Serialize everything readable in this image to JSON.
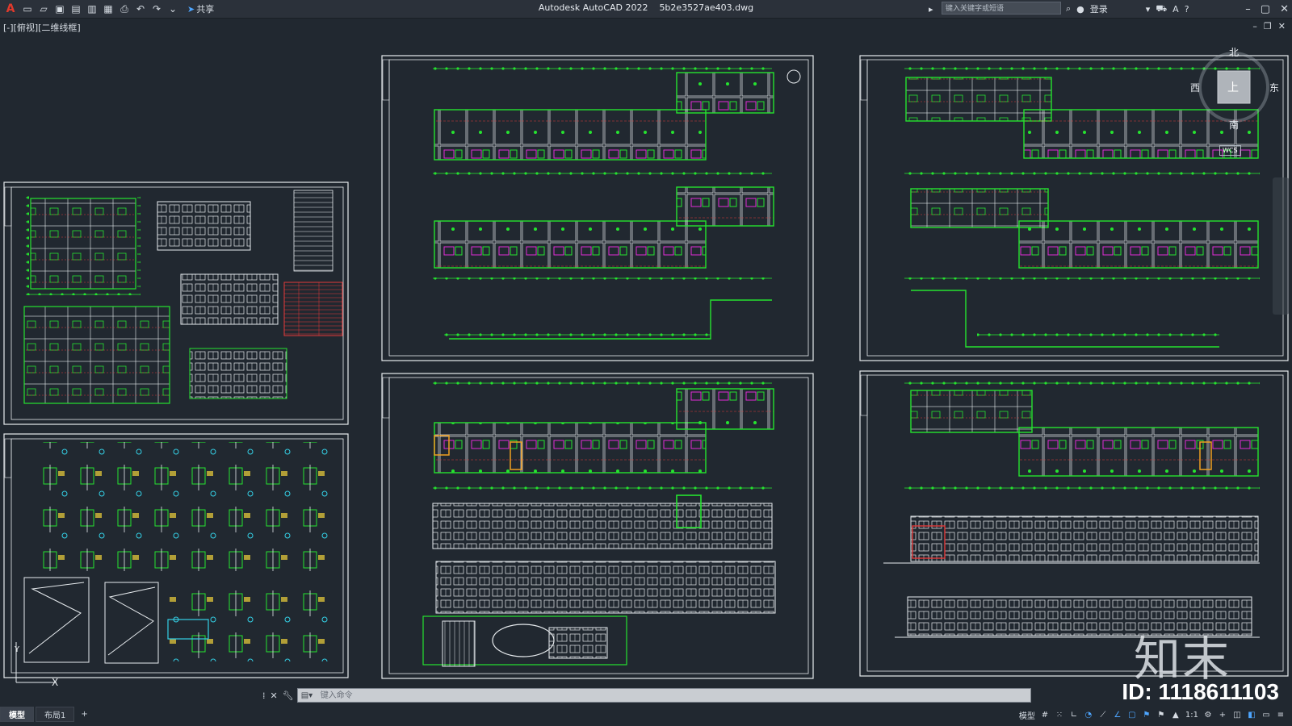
{
  "app": {
    "title": "Autodesk AutoCAD 2022",
    "filename": "5b2e3527ae403.dwg",
    "app_menu_glyph": "A",
    "share_label": "共享",
    "search_placeholder": "键入关键字或短语",
    "login_label": "登录"
  },
  "viewport": {
    "label": "[-][俯视][二维线框]",
    "viewcube": {
      "top": "北",
      "west": "西",
      "east": "东",
      "south": "南",
      "face": "上",
      "wcs": "WCS"
    }
  },
  "command": {
    "placeholder": "键入命令"
  },
  "layout_tabs": [
    {
      "label": "模型",
      "active": true
    },
    {
      "label": "布局1",
      "active": false
    }
  ],
  "add_tab_glyph": "+",
  "status": {
    "model_label": "模型",
    "scale_label": "1:1"
  },
  "watermark": {
    "id_text": "ID: 1118611103",
    "brand": "知末"
  },
  "colors": {
    "background": "#212830",
    "drawing_green": "#25e32f",
    "drawing_white": "#e8ecef",
    "drawing_red": "#e23a3a",
    "drawing_magenta": "#e12bd6",
    "drawing_yellow": "#f0d23a",
    "drawing_cyan": "#33d0e6",
    "accent_blue": "#4ea6ff"
  }
}
